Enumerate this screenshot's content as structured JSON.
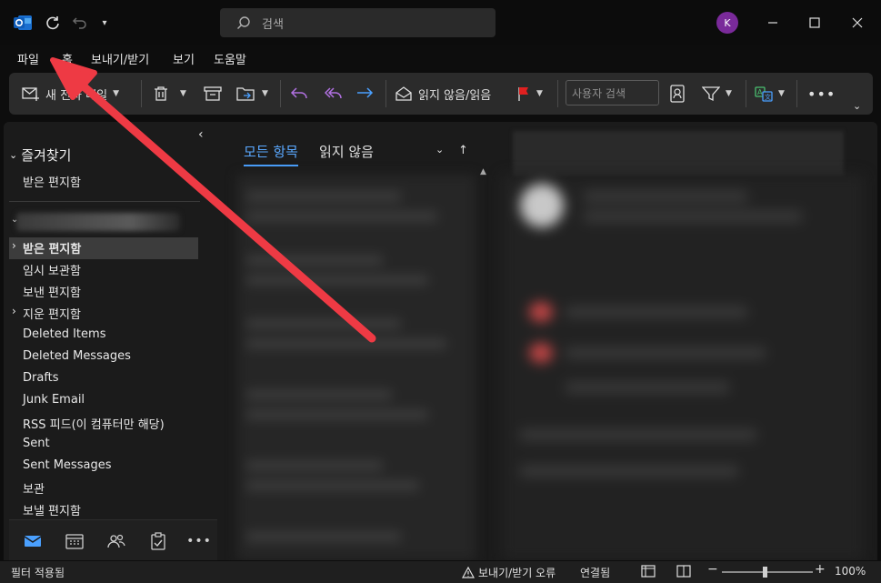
{
  "titlebar": {
    "search_placeholder": "검색",
    "avatar_initial": "K"
  },
  "menu": {
    "items": [
      "파일",
      "홈",
      "보내기/받기",
      "보기",
      "도움말"
    ],
    "active": "홈"
  },
  "ribbon": {
    "new_mail": "새 전자 메일",
    "read_unread": "읽지 않음/읽음",
    "user_search_placeholder": "사용자 검색"
  },
  "folders": {
    "favorites_header": "즐겨찾기",
    "favorites": [
      "받은 편지함"
    ],
    "items": [
      {
        "label": "받은 편지함",
        "selected": true,
        "expandable": true
      },
      {
        "label": "임시 보관함"
      },
      {
        "label": "보낸 편지함"
      },
      {
        "label": "지운 편지함",
        "expandable": true
      },
      {
        "label": "Deleted Items"
      },
      {
        "label": "Deleted Messages"
      },
      {
        "label": "Drafts"
      },
      {
        "label": "Junk Email"
      },
      {
        "label": "RSS 피드(이 컴퓨터만 해당)"
      },
      {
        "label": "Sent"
      },
      {
        "label": "Sent Messages"
      },
      {
        "label": "보관"
      },
      {
        "label": "보낼 편지함"
      }
    ]
  },
  "message_list": {
    "tab_all": "모든 항목",
    "tab_unread": "읽지 않음"
  },
  "status": {
    "filter": "필터 적용됨",
    "sendrecv_error": "보내기/받기 오류",
    "connected": "연결됨",
    "zoom": "100%"
  },
  "colors": {
    "accent": "#4aa0ff",
    "avatar": "#7a2a9a",
    "flag": "#e02020",
    "annotation_arrow": "#ee3a44"
  }
}
